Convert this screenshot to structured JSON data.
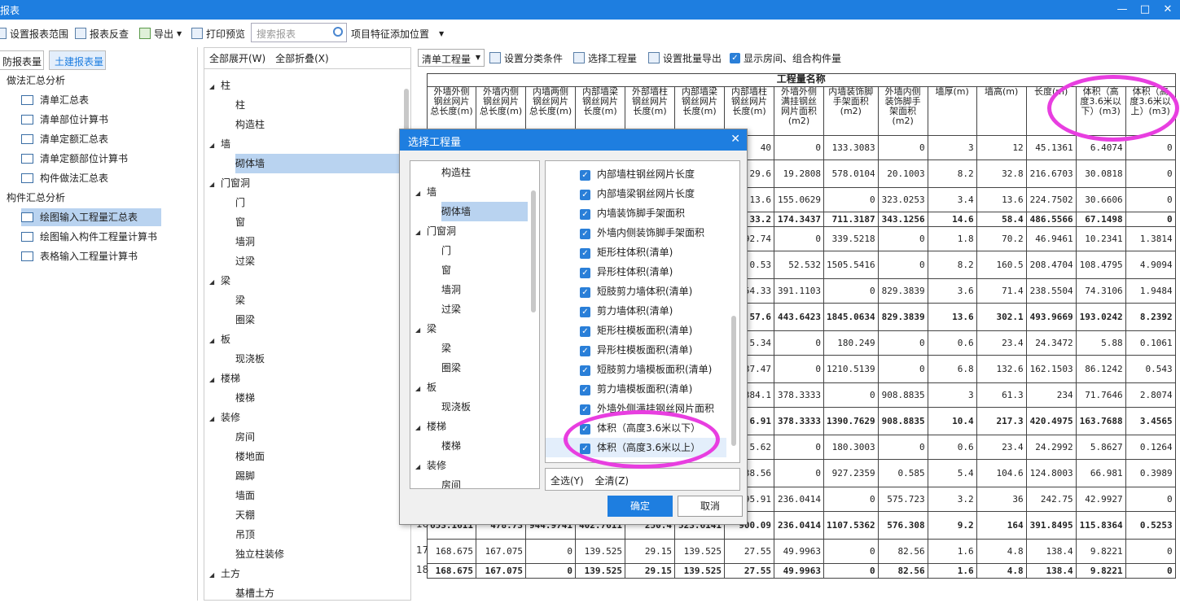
{
  "window": {
    "title": "报表",
    "min": "—",
    "max": "□",
    "close": "✕"
  },
  "toolbar": {
    "set_range": "设置报表范围",
    "recheck": "报表反查",
    "export": "导出",
    "print_preview": "打印预览",
    "search_placeholder": "搜索报表",
    "add_features": "项目特征添加位置"
  },
  "left": {
    "tab_fire": "防报表量",
    "tab_civil": "土建报表量",
    "group1": "做法汇总分析",
    "items1": [
      "清单汇总表",
      "清单部位计算书",
      "清单定额汇总表",
      "清单定额部位计算书",
      "构件做法汇总表"
    ],
    "group2": "构件汇总分析",
    "items2": [
      "绘图输入工程量汇总表",
      "绘图输入构件工程量计算书",
      "表格输入工程量计算书"
    ]
  },
  "mid": {
    "expand_all": "全部展开(W)",
    "collapse_all": "全部折叠(X)",
    "tree": [
      "柱",
      "柱",
      "构造柱",
      "墙",
      "砌体墙",
      "门窗洞",
      "门",
      "窗",
      "墙洞",
      "过梁",
      "梁",
      "梁",
      "圈梁",
      "板",
      "现浇板",
      "楼梯",
      "楼梯",
      "装修",
      "房间",
      "楼地面",
      "踢脚",
      "墙面",
      "天棚",
      "吊顶",
      "独立柱装修",
      "土方",
      "基槽土方"
    ]
  },
  "right_toolbar": {
    "combo": "清单工程量",
    "set_cat": "设置分类条件",
    "select_qty": "选择工程量",
    "batch_export": "设置批量导出",
    "show_rooms": "显示房间、组合构件量"
  },
  "table": {
    "title": "工程量名称",
    "headers": [
      "外墙外侧钢丝网片总长度(m)",
      "外墙内侧钢丝网片总长度(m)",
      "内墙两侧钢丝网片总长度(m)",
      "内部墙梁钢丝网片长度(m)",
      "外部墙柱钢丝网片长度(m)",
      "内部墙梁钢丝网片长度(m)",
      "内部墙柱钢丝网片长度(m)",
      "外墙外侧满挂钢丝网片面积(m2)",
      "内墙装饰脚手架面积(m2)",
      "外墙内侧装饰脚手架面积(m2)",
      "墙厚(m)",
      "墙高(m)",
      "长度(m)",
      "体积（高度3.6米以下）(m3)",
      "体积（高度3.6米以上）(m3)"
    ],
    "rows": [
      {
        "n": "",
        "b": false,
        "c": [
          "",
          "",
          "",
          "",
          "",
          "",
          "40",
          "0",
          "133.3083",
          "0",
          "3",
          "12",
          "45.1361",
          "6.4074",
          "0"
        ]
      },
      {
        "n": "",
        "b": false,
        "c": [
          "",
          "",
          "",
          "",
          "",
          "",
          "29.6",
          "19.2808",
          "578.0104",
          "20.1003",
          "8.2",
          "32.8",
          "216.6703",
          "30.0818",
          "0"
        ]
      },
      {
        "n": "",
        "b": false,
        "c": [
          "",
          "",
          "",
          "",
          "",
          "",
          "13.6",
          "155.0629",
          "0",
          "323.0253",
          "3.4",
          "13.6",
          "224.7502",
          "30.6606",
          "0"
        ]
      },
      {
        "n": "",
        "b": true,
        "c": [
          "",
          "",
          "",
          "",
          "",
          "",
          "33.2",
          "174.3437",
          "711.3187",
          "343.1256",
          "14.6",
          "58.4",
          "486.5566",
          "67.1498",
          "0"
        ]
      },
      {
        "n": "",
        "b": false,
        "c": [
          "",
          "",
          "",
          "",
          "",
          "",
          "92.74",
          "0",
          "339.5218",
          "0",
          "1.8",
          "70.2",
          "46.9461",
          "10.2341",
          "1.3814"
        ]
      },
      {
        "n": "",
        "b": false,
        "c": [
          "",
          "",
          "",
          "",
          "",
          "",
          "0.53",
          "52.532",
          "1505.5416",
          "0",
          "8.2",
          "160.5",
          "208.4704",
          "108.4795",
          "4.9094"
        ]
      },
      {
        "n": "",
        "b": false,
        "c": [
          "",
          "",
          "",
          "",
          "",
          "",
          "54.33",
          "391.1103",
          "0",
          "829.3839",
          "3.6",
          "71.4",
          "238.5504",
          "74.3106",
          "1.9484"
        ]
      },
      {
        "n": "",
        "b": true,
        "c": [
          "",
          "",
          "",
          "",
          "",
          "",
          "57.6",
          "443.6423",
          "1845.0634",
          "829.3839",
          "13.6",
          "302.1",
          "493.9669",
          "193.0242",
          "8.2392"
        ]
      },
      {
        "n": "",
        "b": false,
        "c": [
          "",
          "",
          "",
          "",
          "",
          "",
          "5.34",
          "0",
          "180.249",
          "0",
          "0.6",
          "23.4",
          "24.3472",
          "5.88",
          "0.1061"
        ]
      },
      {
        "n": "",
        "b": false,
        "c": [
          "",
          "",
          "",
          "",
          "",
          "",
          "37.47",
          "0",
          "1210.5139",
          "0",
          "6.8",
          "132.6",
          "162.1503",
          "86.1242",
          "0.543"
        ]
      },
      {
        "n": "",
        "b": false,
        "c": [
          "",
          "",
          "",
          "",
          "",
          "",
          "384.1",
          "378.3333",
          "0",
          "908.8835",
          "3",
          "61.3",
          "234",
          "71.7646",
          "2.8074"
        ]
      },
      {
        "n": "",
        "b": true,
        "c": [
          "",
          "",
          "",
          "",
          "",
          "",
          "6.91",
          "378.3333",
          "1390.7629",
          "908.8835",
          "10.4",
          "217.3",
          "420.4975",
          "163.7688",
          "3.4565"
        ]
      },
      {
        "n": "",
        "b": false,
        "c": [
          "",
          "",
          "",
          "",
          "",
          "",
          "5.62",
          "0",
          "180.3003",
          "0",
          "0.6",
          "23.4",
          "24.2992",
          "5.8627",
          "0.1264"
        ]
      },
      {
        "n": "",
        "b": false,
        "c": [
          "",
          "",
          "",
          "",
          "",
          "",
          "38.56",
          "0",
          "927.2359",
          "0.585",
          "5.4",
          "104.6",
          "124.8003",
          "66.981",
          "0.3989"
        ]
      },
      {
        "n": "",
        "b": false,
        "c": [
          "",
          "",
          "",
          "",
          "",
          "",
          "95.91",
          "236.0414",
          "0",
          "575.723",
          "3.2",
          "36",
          "242.75",
          "42.9927",
          "0"
        ]
      },
      {
        "n": "16",
        "b": true,
        "c": [
          "653.1611",
          "478.73",
          "944.9741",
          "402.7611",
          "250.4",
          "523.6141",
          "900.09",
          "236.0414",
          "1107.5362",
          "576.308",
          "9.2",
          "164",
          "391.8495",
          "115.8364",
          "0.5253"
        ]
      },
      {
        "n": "17",
        "b": false,
        "c": [
          "168.675",
          "167.075",
          "0",
          "139.525",
          "29.15",
          "139.525",
          "27.55",
          "49.9963",
          "0",
          "82.56",
          "1.6",
          "4.8",
          "138.4",
          "9.8221",
          "0"
        ]
      },
      {
        "n": "18",
        "b": true,
        "c": [
          "168.675",
          "167.075",
          "0",
          "139.525",
          "29.15",
          "139.525",
          "27.55",
          "49.9963",
          "0",
          "82.56",
          "1.6",
          "4.8",
          "138.4",
          "9.8221",
          "0"
        ]
      }
    ]
  },
  "dialog": {
    "title": "选择工程量",
    "close": "✕",
    "tree": [
      "构造柱",
      "墙",
      "砌体墙",
      "门窗洞",
      "门",
      "窗",
      "墙洞",
      "过梁",
      "梁",
      "梁",
      "圈梁",
      "板",
      "现浇板",
      "楼梯",
      "楼梯",
      "装修",
      "房间"
    ],
    "checks": [
      "内部墙柱钢丝网片长度",
      "内部墙梁钢丝网片长度",
      "内墙装饰脚手架面积",
      "外墙内侧装饰脚手架面积",
      "矩形柱体积(清单)",
      "异形柱体积(清单)",
      "短肢剪力墙体积(清单)",
      "剪力墙体积(清单)",
      "矩形柱模板面积(清单)",
      "异形柱模板面积(清单)",
      "短肢剪力墙模板面积(清单)",
      "剪力墙模板面积(清单)",
      "外墙外侧满挂钢丝网片面积",
      "体积（高度3.6米以下）",
      "体积（高度3.6米以上）"
    ],
    "select_all": "全选(Y)",
    "clear_all": "全清(Z)",
    "ok": "确定",
    "cancel": "取消"
  },
  "colors": {
    "accent": "#1e7ee0",
    "annotation": "#e83ee0"
  }
}
